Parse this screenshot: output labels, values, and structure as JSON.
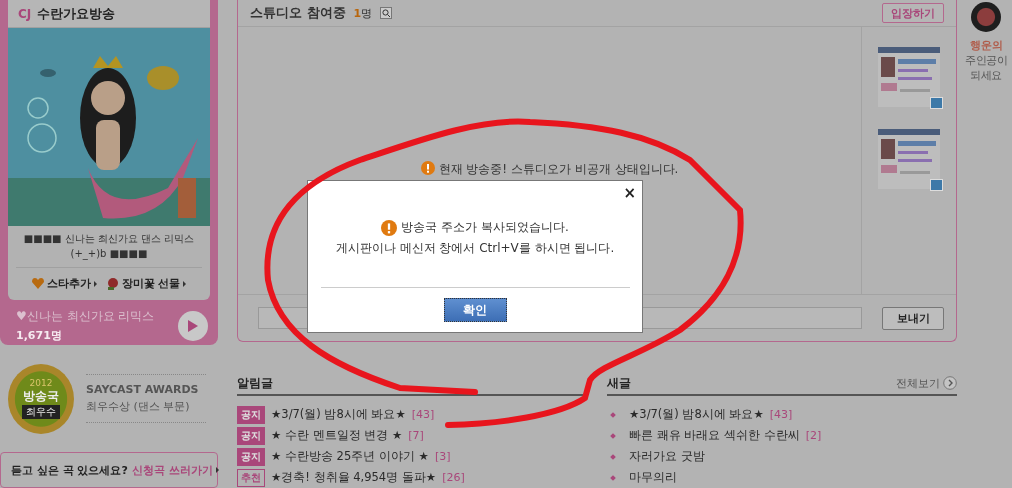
{
  "left_panel": {
    "station": {
      "prefix": "CJ",
      "name": "수란가요방송"
    },
    "caption": [
      "■■■■ 신나는 최신가요 댄스 리믹스",
      "(+_+)b ■■■■"
    ],
    "actions": [
      {
        "kind": "star",
        "label": "스타추가"
      },
      {
        "kind": "rose",
        "label": "장미꽃 선물"
      }
    ],
    "now_playing": {
      "title": "♥신나는 최신가요 리믹스",
      "listeners": "1,671명"
    }
  },
  "award": {
    "year": "2012",
    "badge": "방송국",
    "rank": "최우수",
    "title": "SAYCAST AWARDS",
    "subtitle": "최우수상 (댄스 부문)"
  },
  "request_bar": {
    "question": "듣고 싶은 곡 있으세요?",
    "link": "신청곡 쓰러가기"
  },
  "studio": {
    "title": "스튜디오 참여중",
    "count": "1",
    "count_unit": "명",
    "enter_button": "입장하기",
    "notice": "현재 방송중! 스튜디오가 비공개 상태입니다.",
    "send_button": "보내기"
  },
  "notices": {
    "title": "알림글",
    "items": [
      {
        "kind": "notice",
        "tag": "공지",
        "text": "★3/7(월) 밤8시에 봐요★",
        "comments": "[43]"
      },
      {
        "kind": "notice",
        "tag": "공지",
        "text": "★ 수란 멘트일정 변경 ★",
        "comments": "[7]"
      },
      {
        "kind": "notice",
        "tag": "공지",
        "text": "★ 수란방송 25주년 이야기 ★",
        "comments": "[3]"
      },
      {
        "kind": "recommend",
        "tag": "추천",
        "text": "★경축! 청취율 4,954명 돌파★",
        "comments": "[26]"
      }
    ]
  },
  "new_posts": {
    "title": "새글",
    "more": "전체보기",
    "items": [
      {
        "text": "★3/7(월) 밤8시에 봐요★",
        "comments": "[43]"
      },
      {
        "text": "빠른 쾌유 바래요 섹쉬한 수란씨",
        "comments": "[2]"
      },
      {
        "text": "자러가요 굿밤"
      },
      {
        "text": "마무의리"
      }
    ]
  },
  "promo": {
    "highlight": "행운의",
    "lines": [
      "주인공이",
      "되세요"
    ]
  },
  "dialog": {
    "close": "×",
    "message": "방송국 주소가 복사되었습니다.",
    "detail": "게시판이나 메신저 창에서 Ctrl+V를 하시면 됩니다.",
    "ok_button": "확인"
  }
}
